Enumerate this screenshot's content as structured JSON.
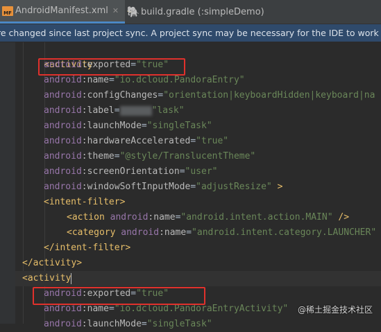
{
  "tabs": [
    {
      "label": "AndroidManifest.xml",
      "close": "✕",
      "icon": "xml-file-icon"
    },
    {
      "label": "build.gradle (:simpleDemo)",
      "icon": "gradle-elephant-icon"
    }
  ],
  "banner": {
    "text": "re changed since last project sync. A project sync may be necessary for the IDE to work properly."
  },
  "code": {
    "activity_open": "<activity",
    "exported_1": {
      "ns": "android",
      "attr": ":exported",
      "val": "\"true\""
    },
    "name_1": {
      "ns": "android",
      "attr": ":name",
      "val": "\"io.dcloud.PandoraEntry\""
    },
    "configChanges": {
      "ns": "android",
      "attr": ":configChanges",
      "val": "\"orientation|keyboardHidden|keyboard|na"
    },
    "label": {
      "ns": "android",
      "attr": ":label",
      "val": "\"lask\""
    },
    "launchMode": {
      "ns": "android",
      "attr": ":launchMode",
      "val": "\"singleTask\""
    },
    "hardwareAccelerated": {
      "ns": "android",
      "attr": ":hardwareAccelerated",
      "val": "\"true\""
    },
    "theme": {
      "ns": "android",
      "attr": ":theme",
      "val": "\"@style/TranslucentTheme\""
    },
    "screenOrientation": {
      "ns": "android",
      "attr": ":screenOrientation",
      "val": "\"user\""
    },
    "windowSoftInputMode": {
      "ns": "android",
      "attr": ":windowSoftInputMode",
      "val": "\"adjustResize\"",
      "end": " >"
    },
    "intent_filter_open": "<intent-filter>",
    "action": {
      "tag": "<action ",
      "ns": "android",
      "attr": ":name",
      "val": "\"android.intent.action.MAIN\"",
      "end": " />"
    },
    "category": {
      "tag": "<category ",
      "ns": "android",
      "attr": ":name",
      "val": "\"android.intent.category.LAUNCHER\""
    },
    "intent_filter_close": "</intent-filter>",
    "activity_close": "</activity>",
    "activity_open_2": "<activity",
    "exported_2": {
      "ns": "android",
      "attr": ":exported",
      "val": "\"true\""
    },
    "name_2": {
      "ns": "android",
      "attr": ":name",
      "val": "\"io.dcloud.PandoraEntryActivity\""
    },
    "launchMode_2": {
      "ns": "android",
      "attr": ":launchMode",
      "val": "\"singleTask\""
    }
  },
  "watermark": "@稀土掘金技术社区",
  "colors": {
    "highlight_box": "#e0312c",
    "banner_bg": "#2f4a6b",
    "editor_bg": "#2b2b2b"
  }
}
